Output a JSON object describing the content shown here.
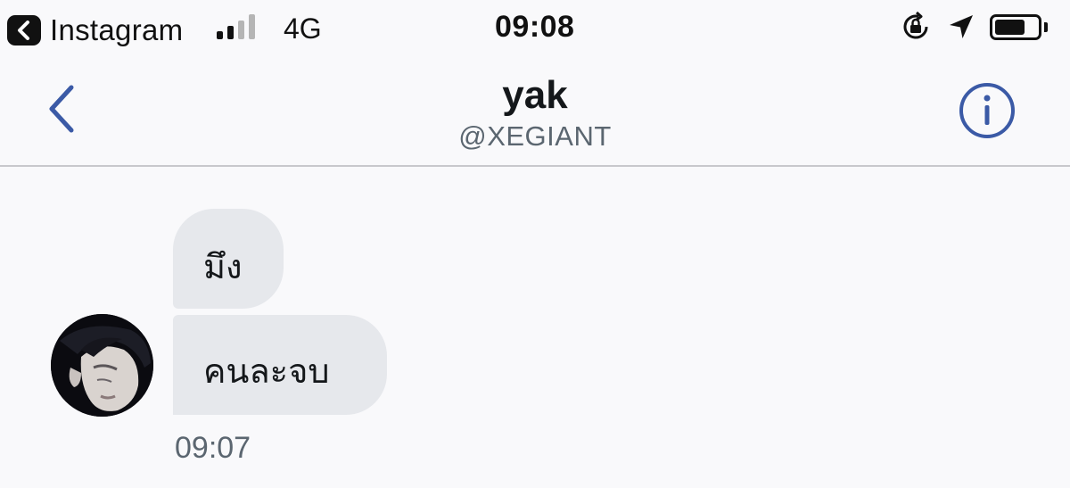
{
  "status_bar": {
    "back_app_label": "Instagram",
    "network": "4G",
    "time": "09:08",
    "signal_bars_active": 2,
    "signal_bars_total": 4,
    "battery_level": 0.72,
    "icons": [
      "back-app-icon",
      "orientation-lock-icon",
      "location-arrow-icon",
      "battery-icon"
    ]
  },
  "header": {
    "title": "yak",
    "subtitle": "@XEGIANT",
    "accent_color": "#3b5aa6"
  },
  "conversation": {
    "messages": [
      {
        "text": "มึง"
      },
      {
        "text": "คนละจบ"
      }
    ],
    "timestamp": "09:07",
    "bubble_color": "#e6e8ec"
  }
}
